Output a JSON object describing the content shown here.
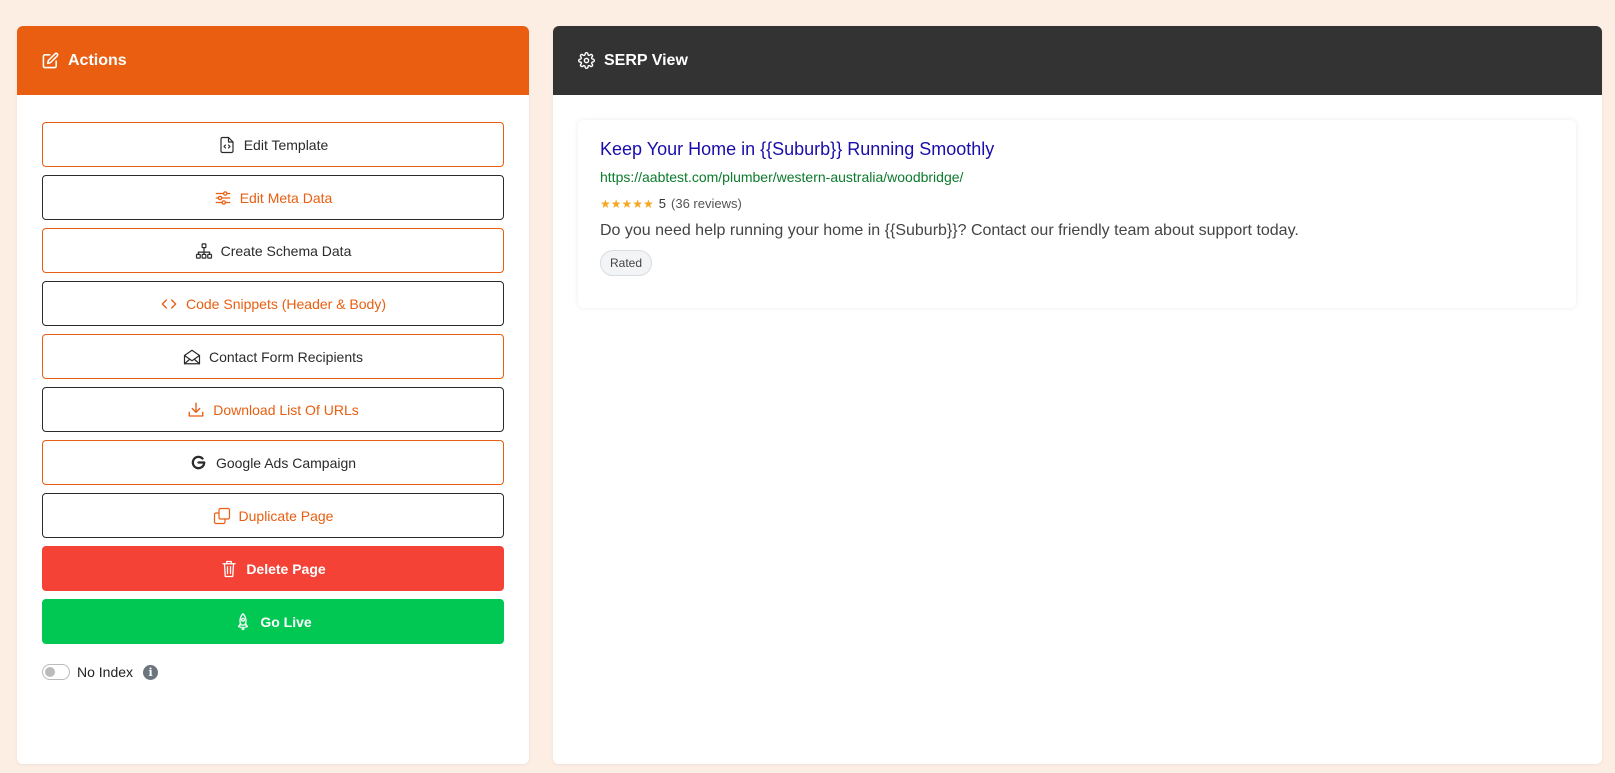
{
  "actions_panel": {
    "title": "Actions",
    "icon": "edit-square-icon",
    "buttons": [
      {
        "label": "Edit Template",
        "icon": "file-code-icon"
      },
      {
        "label": "Edit Meta Data",
        "icon": "sliders-icon"
      },
      {
        "label": "Create Schema Data",
        "icon": "sitemap-icon"
      },
      {
        "label": "Code Snippets (Header & Body)",
        "icon": "code-icon"
      },
      {
        "label": "Contact Form Recipients",
        "icon": "envelope-open-icon"
      },
      {
        "label": "Download List Of URLs",
        "icon": "download-icon"
      },
      {
        "label": "Google Ads Campaign",
        "icon": "google-icon"
      },
      {
        "label": "Duplicate Page",
        "icon": "copy-icon"
      },
      {
        "label": "Delete Page",
        "icon": "trash-icon"
      },
      {
        "label": "Go Live",
        "icon": "rocket-icon"
      }
    ],
    "no_index": {
      "label": "No Index",
      "checked": false,
      "info_glyph": "i"
    }
  },
  "serp_panel": {
    "title": "SERP View",
    "icon": "gear-icon",
    "result": {
      "title": "Keep Your Home in {{Suburb}} Running Smoothly",
      "url": "https://aabtest.com/plumber/western-australia/woodbridge/",
      "stars": "★★★★★",
      "rating": "5",
      "reviews": "(36 reviews)",
      "description": "Do you need help running your home in {{Suburb}}? Contact our friendly team about support today.",
      "badge": "Rated"
    }
  },
  "colors": {
    "accent": "#e95e10",
    "dark_header": "#333333",
    "danger": "#f44336",
    "success": "#00c853",
    "link": "#1a0dab",
    "url": "#0b7a2b",
    "background": "#fdeee4"
  }
}
